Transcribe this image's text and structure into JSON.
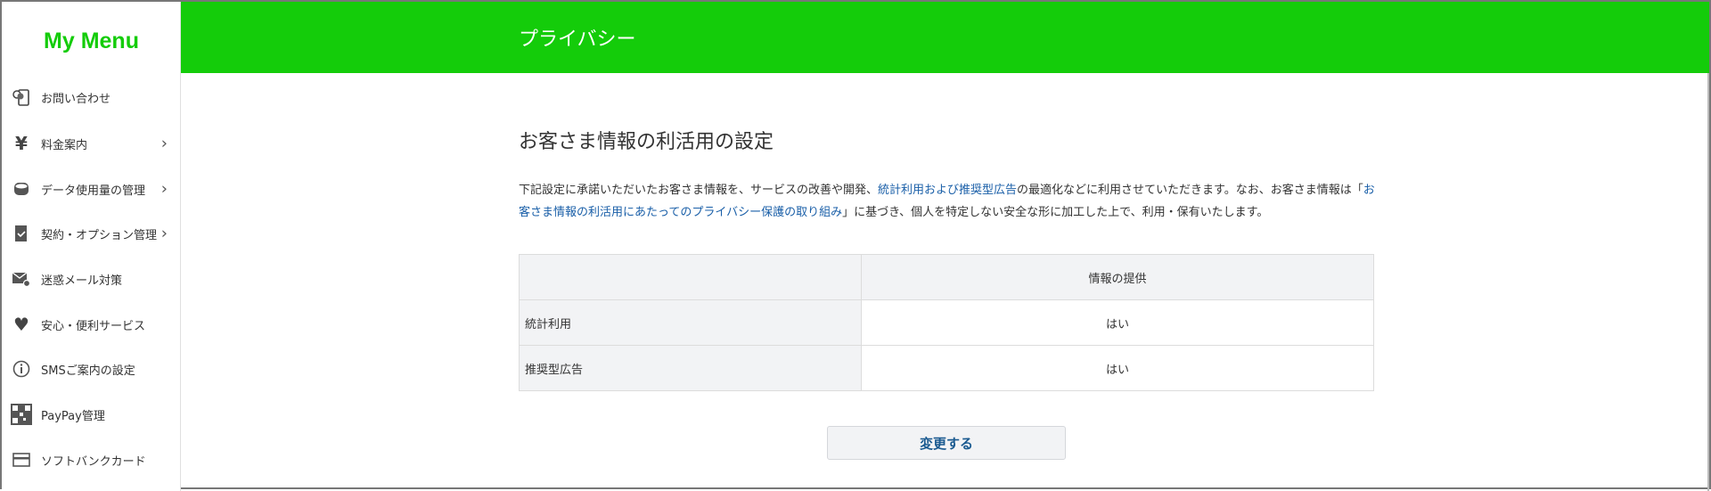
{
  "sidebar": {
    "logo": "My Menu",
    "items": [
      {
        "label": "お問い合わせ",
        "icon": "support-phone-icon",
        "chevron": false
      },
      {
        "label": "料金案内",
        "icon": "yen-icon",
        "chevron": true
      },
      {
        "label": "データ使用量の管理",
        "icon": "database-icon",
        "chevron": true
      },
      {
        "label": "契約・オプション管理",
        "icon": "contract-check-icon",
        "chevron": true
      },
      {
        "label": "迷惑メール対策",
        "icon": "mail-gear-icon",
        "chevron": false
      },
      {
        "label": "安心・便利サービス",
        "icon": "heart-icon",
        "chevron": false
      },
      {
        "label": "SMSご案内の設定",
        "icon": "info-icon",
        "chevron": false
      },
      {
        "label": "PayPay管理",
        "icon": "qr-code-icon",
        "chevron": false
      },
      {
        "label": "ソフトバンクカード",
        "icon": "card-icon",
        "chevron": false
      }
    ]
  },
  "header": {
    "title": "プライバシー"
  },
  "main": {
    "title": "お客さま情報の利活用の設定",
    "desc": {
      "p1": "下記設定に承諾いただいたお客さま情報を、サービスの改善や開発、",
      "link1": "統計利用および推奨型広告",
      "p2": "の最適化などに利用させていただきます。なお、お客さま情報は「",
      "link2": "お客さま情報の利活用にあたってのプライバシー保護の取り組み",
      "p3": "」に基づき、個人を特定しない安全な形に加工した上で、利用・保有いたします。"
    },
    "table": {
      "header": [
        "",
        "情報の提供"
      ],
      "rows": [
        [
          "統計利用",
          "はい"
        ],
        [
          "推奨型広告",
          "はい"
        ]
      ]
    },
    "button": "変更する"
  },
  "colors": {
    "brand": "#14cc0a",
    "link": "#1a5fa8"
  }
}
